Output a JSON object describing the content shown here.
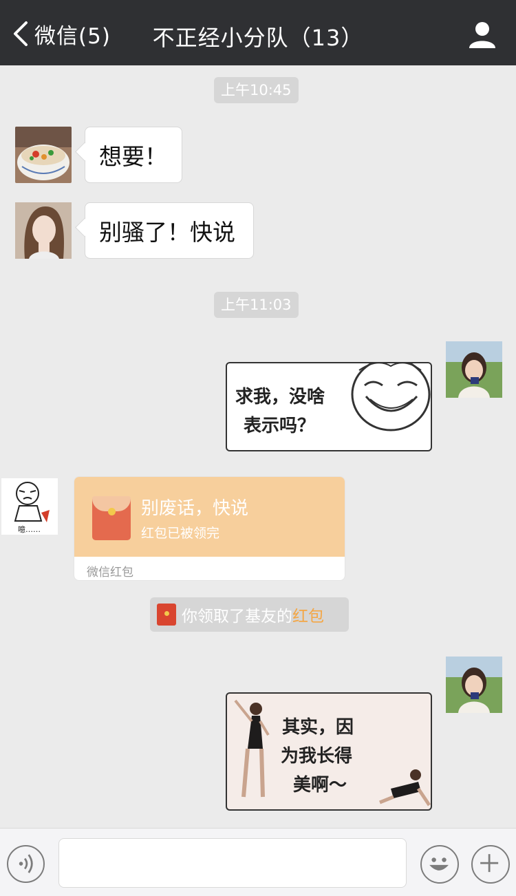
{
  "header": {
    "back_label": "微信(5)",
    "title": "不正经小分队（13）"
  },
  "messages": {
    "time1": "上午10:45",
    "msg1": "想要！",
    "msg2": "别骚了！快说",
    "time2": "上午11:03",
    "sticker1_line1": "求我，没啥",
    "sticker1_line2": "表示吗？",
    "sender3_caption": "噫……",
    "sticker2_line1": "其实，因",
    "sticker2_line2": "为我长得",
    "sticker2_line3": "美啊～"
  },
  "red_packet": {
    "title": "别废话，快说",
    "status": "红包已被领完",
    "brand": "微信红包"
  },
  "notice": {
    "text": "你领取了基友的",
    "link": "红包"
  },
  "input": {
    "value": ""
  },
  "colors": {
    "header_bg": "#2f3033",
    "chat_bg": "#ebebeb",
    "packet": "#f7cf9c",
    "link": "#f4a644"
  }
}
